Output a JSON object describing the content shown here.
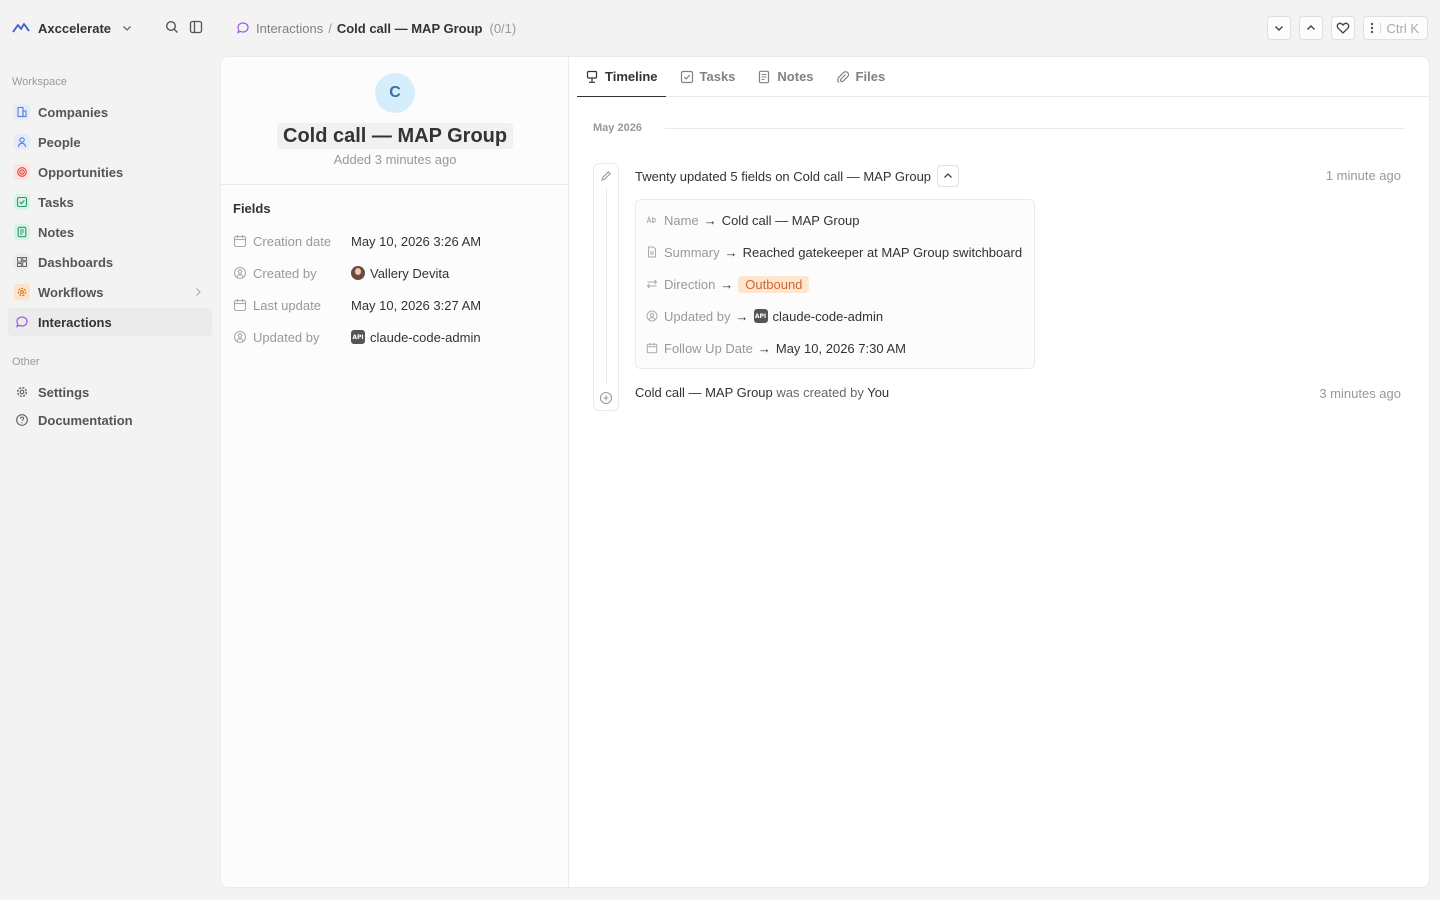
{
  "app": {
    "workspace_name": "Axccelerate"
  },
  "breadcrumb": {
    "parent": "Interactions",
    "separator": "/",
    "current": "Cold call — MAP Group",
    "count": "(0/1)"
  },
  "topbar": {
    "command_shortcut": "Ctrl K"
  },
  "sidebar": {
    "workspace_label": "Workspace",
    "other_label": "Other",
    "items": [
      {
        "label": "Companies",
        "icon": "building-icon",
        "color": "#5a7fd6",
        "bg": "#e4ecfb"
      },
      {
        "label": "People",
        "icon": "user-icon",
        "color": "#5a7fd6",
        "bg": "#e4ecfb"
      },
      {
        "label": "Opportunities",
        "icon": "target-icon",
        "color": "#e0463c",
        "bg": "#fde3e1"
      },
      {
        "label": "Tasks",
        "icon": "checkbox-icon",
        "color": "#2e9a6a",
        "bg": "#d9f2e6"
      },
      {
        "label": "Notes",
        "icon": "notes-icon",
        "color": "#2e9a6a",
        "bg": "#d9f2e6"
      },
      {
        "label": "Dashboards",
        "icon": "dashboard-icon",
        "color": "#666666",
        "bg": "#ececec"
      },
      {
        "label": "Workflows",
        "icon": "settings-automation-icon",
        "color": "#e37a1f",
        "bg": "#fde3cc"
      },
      {
        "label": "Interactions",
        "icon": "message-icon",
        "color": "#9b5ae0",
        "bg": "transparent",
        "active": true
      }
    ],
    "other_items": [
      {
        "label": "Settings",
        "icon": "gear-icon"
      },
      {
        "label": "Documentation",
        "icon": "help-circle-icon"
      }
    ]
  },
  "record": {
    "avatar_letter": "C",
    "title": "Cold call — MAP Group",
    "subtitle": "Added 3 minutes ago",
    "fields_title": "Fields",
    "fields": [
      {
        "label": "Creation date",
        "value": "May 10, 2026 3:26 AM"
      },
      {
        "label": "Created by",
        "value": "Vallery Devita"
      },
      {
        "label": "Last update",
        "value": "May 10, 2026 3:27 AM"
      },
      {
        "label": "Updated by",
        "value": "claude-code-admin"
      }
    ]
  },
  "tabs": [
    {
      "label": "Timeline",
      "icon": "timeline-icon",
      "active": true
    },
    {
      "label": "Tasks",
      "icon": "checkbox-icon"
    },
    {
      "label": "Notes",
      "icon": "notes-icon"
    },
    {
      "label": "Files",
      "icon": "paperclip-icon"
    }
  ],
  "timeline": {
    "month": "May 2026",
    "event1": {
      "title": "Twenty updated 5 fields on Cold call — MAP Group",
      "time": "1 minute ago",
      "changes": [
        {
          "label": "Name",
          "value": "Cold call — MAP Group"
        },
        {
          "label": "Summary",
          "value": "Reached gatekeeper at MAP Group switchboard"
        },
        {
          "label": "Direction",
          "value": "Outbound"
        },
        {
          "label": "Updated by",
          "value": "claude-code-admin"
        },
        {
          "label": "Follow Up Date",
          "value": "May 10, 2026 7:30 AM"
        }
      ]
    },
    "event2": {
      "subject": "Cold call — MAP Group",
      "action": "was created by",
      "actor": "You",
      "time": "3 minutes ago"
    },
    "arrow": "→",
    "api_badge": "API"
  },
  "colors": {
    "accent_orange_bg": "#fde7d2",
    "accent_orange_text": "#d9622b",
    "avatar_bg": "#d6eefc"
  }
}
